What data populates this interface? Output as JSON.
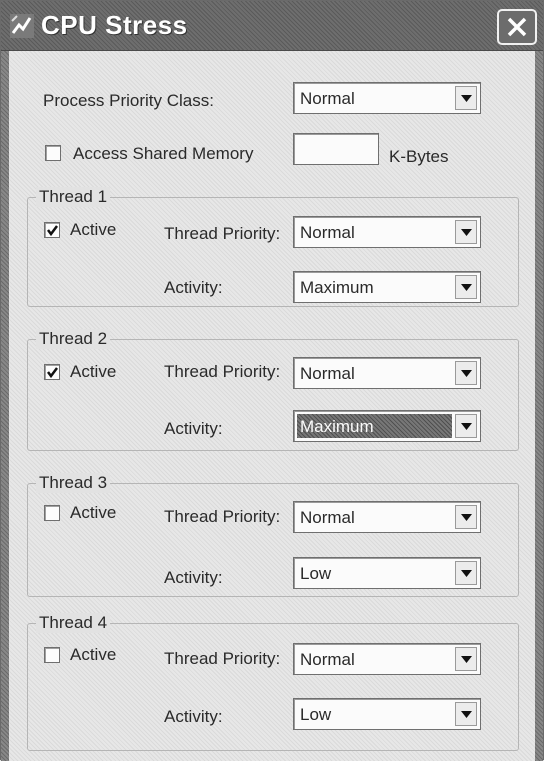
{
  "window": {
    "title": "CPU Stress"
  },
  "process": {
    "priority_label": "Process Priority Class:",
    "priority_value": "Normal",
    "shared_memory_label": "Access Shared Memory",
    "shared_memory_checked": false,
    "shared_memory_value": "",
    "kbytes_label": "K-Bytes"
  },
  "threads": [
    {
      "title": "Thread 1",
      "active_label": "Active",
      "active": true,
      "priority_label": "Thread Priority:",
      "priority_value": "Normal",
      "activity_label": "Activity:",
      "activity_value": "Maximum"
    },
    {
      "title": "Thread 2",
      "active_label": "Active",
      "active": true,
      "priority_label": "Thread Priority:",
      "priority_value": "Normal",
      "activity_label": "Activity:",
      "activity_value": "Maximum"
    },
    {
      "title": "Thread 3",
      "active_label": "Active",
      "active": false,
      "priority_label": "Thread Priority:",
      "priority_value": "Normal",
      "activity_label": "Activity:",
      "activity_value": "Low"
    },
    {
      "title": "Thread 4",
      "active_label": "Active",
      "active": false,
      "priority_label": "Thread Priority:",
      "priority_value": "Normal",
      "activity_label": "Activity:",
      "activity_value": "Low"
    }
  ],
  "icons": {
    "app": "stress-app-icon",
    "close": "close-icon",
    "dropdown": "chevron-down-icon",
    "check": "checkmark-icon"
  }
}
